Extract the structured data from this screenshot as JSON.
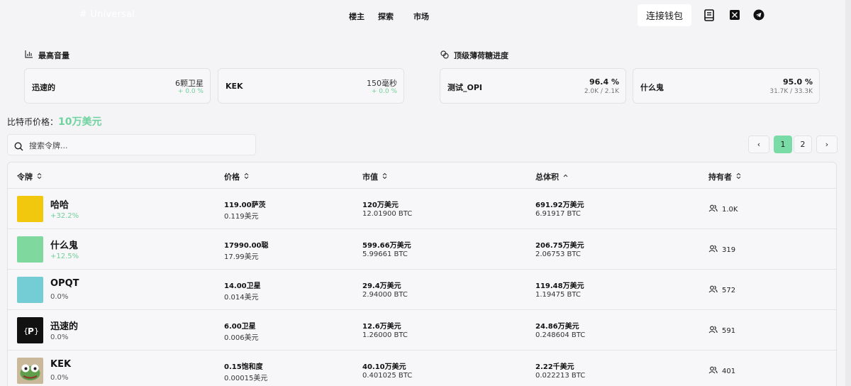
{
  "header": {
    "logo": "# Universal",
    "nav": [
      "楼主",
      "探索",
      "市场"
    ],
    "connect_wallet": "连接钱包",
    "icons": [
      "book-icon",
      "x-icon",
      "telegram-icon"
    ]
  },
  "top_volume": {
    "title": "最高音量",
    "cards": [
      {
        "name": "迅速的",
        "value": "6颗卫星",
        "change": "+ 0.0 %"
      },
      {
        "name": "KEK",
        "value": "150毫秒",
        "change": "+ 0.0 %"
      }
    ]
  },
  "mint_progress": {
    "title": "顶级薄荷糖进度",
    "cards": [
      {
        "name": "测试_OPI",
        "percent": "96.4 %",
        "count": "2.0K / 2.1K"
      },
      {
        "name": "什么鬼",
        "percent": "95.0 %",
        "count": "31.7K / 33.3K"
      }
    ]
  },
  "btc_price": {
    "label": "比特币价格：",
    "value": "10万美元"
  },
  "search": {
    "placeholder": "搜索令牌..."
  },
  "pagination": {
    "prev": "‹",
    "pages": [
      "1",
      "2"
    ],
    "next": "›",
    "active": "1"
  },
  "table": {
    "headers": [
      "令牌",
      "价格",
      "市值",
      "总体积",
      "持有者"
    ],
    "rows": [
      {
        "name": "哈哈",
        "change": "+32.2%",
        "change_up": true,
        "color": "#f2c80f",
        "price": "119.00萨茨",
        "price_usd": "0.119美元",
        "mcap": "120万美元",
        "mcap_btc": "12.01900 BTC",
        "volume": "691.92万美元",
        "volume_btc": "6.91917 BTC",
        "holders": "1.0K"
      },
      {
        "name": "什么鬼",
        "change": "+12.5%",
        "change_up": true,
        "color": "#7fd89e",
        "price": "17990.00聪",
        "price_usd": "17.99美元",
        "mcap": "599.66万美元",
        "mcap_btc": "5.99661 BTC",
        "volume": "206.75万美元",
        "volume_btc": "2.06753 BTC",
        "holders": "319"
      },
      {
        "name": "OPQT",
        "change": "0.0%",
        "change_up": false,
        "color": "#74ccd4",
        "price": "14.00卫星",
        "price_usd": "0.014美元",
        "mcap": "29.4万美元",
        "mcap_btc": "2.94000 BTC",
        "volume": "119.48万美元",
        "volume_btc": "1.19475 BTC",
        "holders": "572"
      },
      {
        "name": "迅速的",
        "change": "0.0%",
        "change_up": false,
        "color": "#111111",
        "price": "6.00卫星",
        "price_usd": "0.006美元",
        "mcap": "12.6万美元",
        "mcap_btc": "1.26000 BTC",
        "volume": "24.86万美元",
        "volume_btc": "0.248604 BTC",
        "holders": "591"
      },
      {
        "name": "KEK",
        "change": "0.0%",
        "change_up": false,
        "color": "#c9b89a",
        "price": "0.15饱和度",
        "price_usd": "0.00015美元",
        "mcap": "40.10万美元",
        "mcap_btc": "0.401025 BTC",
        "volume": "2.22千美元",
        "volume_btc": "0.022213 BTC",
        "holders": "401"
      }
    ]
  }
}
